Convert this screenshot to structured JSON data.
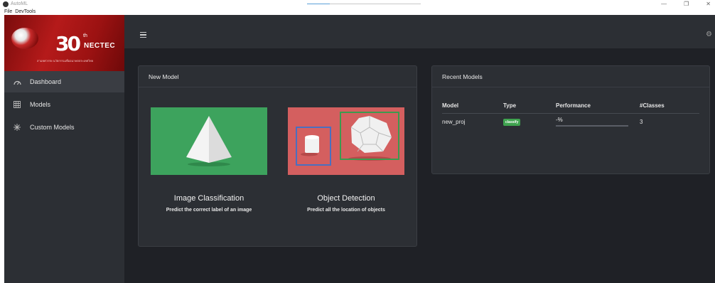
{
  "window": {
    "title": "AutoML",
    "controls": [
      "—",
      "❐",
      "✕"
    ]
  },
  "menu": {
    "items": [
      "File",
      "DevTools"
    ]
  },
  "logo": {
    "number": "30",
    "superscript": "th",
    "brand": "NECTEC",
    "tagline": "สามทศวรรษ นวัตกรรมเพื่ออนาคตประเทศไทย"
  },
  "sidebar": {
    "items": [
      {
        "label": "Dashboard",
        "icon": "dashboard-icon",
        "active": true
      },
      {
        "label": "Models",
        "icon": "grid-icon",
        "active": false
      },
      {
        "label": "Custom Models",
        "icon": "custom-models-icon",
        "active": false
      }
    ]
  },
  "new_model": {
    "title": "New Model",
    "tiles": [
      {
        "title": "Image Classification",
        "subtitle": "Predict the correct label of an image",
        "color": "#3da35d"
      },
      {
        "title": "Object Detection",
        "subtitle": "Predict all the location of objects",
        "color": "#d45f5f"
      }
    ]
  },
  "recent_models": {
    "title": "Recent Models",
    "columns": [
      "Model",
      "Type",
      "Performance",
      "#Classes"
    ],
    "rows": [
      {
        "model": "new_proj",
        "type": "classify",
        "performance": "-%",
        "classes": "3",
        "performance_fill": 0
      }
    ]
  },
  "colors": {
    "sidebar_bg": "#2c2f34",
    "main_bg": "#1f2126",
    "badge_green": "#3fa34f",
    "logo_red": "#b51a1a"
  }
}
